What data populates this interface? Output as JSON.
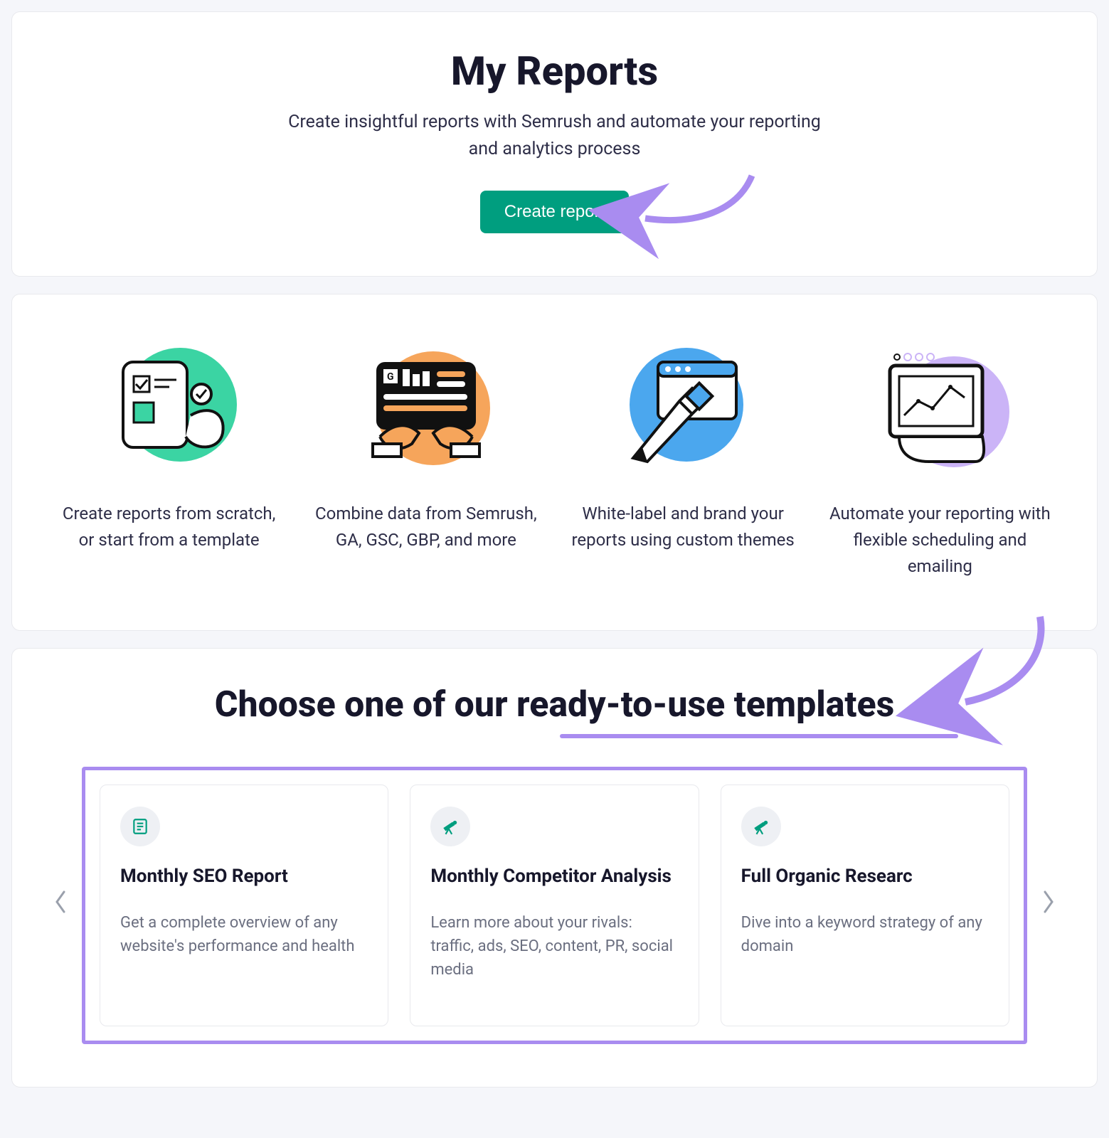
{
  "hero": {
    "title": "My Reports",
    "subtitle": "Create insightful reports with Semrush and automate your reporting and analytics process",
    "cta": "Create report"
  },
  "features": [
    {
      "text": "Create reports from scratch, or start from a template",
      "accent": "#3bd4a3"
    },
    {
      "text": "Combine data from Semrush, GA, GSC, GBP, and more",
      "accent": "#f6a55b"
    },
    {
      "text": "White-label and brand your reports using custom themes",
      "accent": "#4ba7ee"
    },
    {
      "text": "Automate your reporting with flexible scheduling and emailing",
      "accent": "#cbb4f7"
    }
  ],
  "templates": {
    "heading": "Choose one of our ready-to-use templates",
    "items": [
      {
        "icon": "document-icon",
        "title": "Monthly SEO Report",
        "desc": "Get a complete overview of any website's performance and health"
      },
      {
        "icon": "telescope-icon",
        "title": "Monthly Competitor Analysis",
        "desc": "Learn more about your rivals: traffic, ads, SEO, content, PR, social media"
      },
      {
        "icon": "telescope-icon",
        "title": "Full Organic Researc",
        "desc": "Dive into a keyword strategy of any domain"
      }
    ]
  },
  "annotations": {
    "arrow_color": "#a98cf0"
  }
}
